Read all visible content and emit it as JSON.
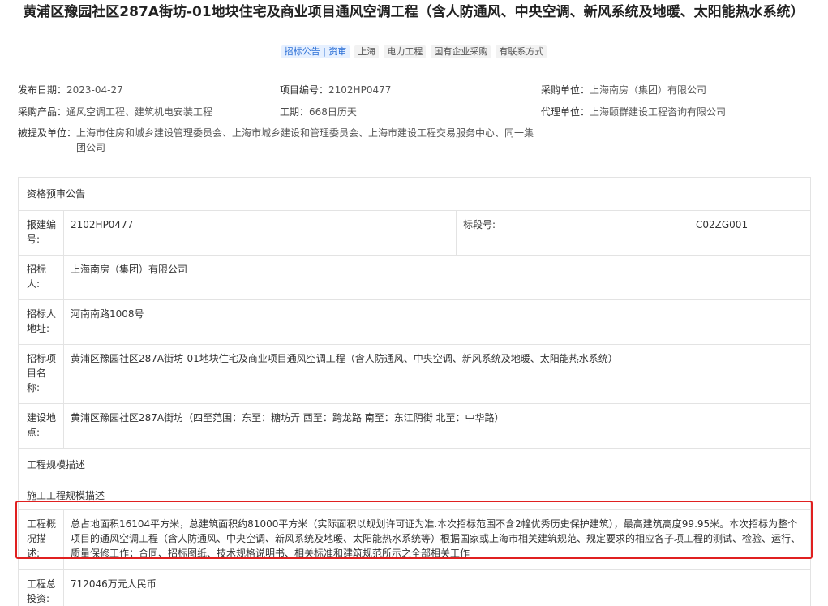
{
  "title": "黄浦区豫园社区287A街坊-01地块住宅及商业项目通风空调工程（含人防通风、中央空调、新风系统及地暖、太阳能热水系统）",
  "tags": [
    "招标公告 | 资审",
    "上海",
    "电力工程",
    "国有企业采购",
    "有联系方式"
  ],
  "meta": {
    "publish_date_label": "发布日期：",
    "publish_date": "2023-04-27",
    "project_no_label": "项目编号：",
    "project_no": "2102HP0477",
    "buyer_label": "采购单位：",
    "buyer": "上海南房（集团）有限公司",
    "product_label": "采购产品：",
    "product": "通风空调工程、建筑机电安装工程",
    "duration_label": "工期：",
    "duration": "668日历天",
    "agent_label": "代理单位：",
    "agent": "上海颐群建设工程咨询有限公司",
    "mentioned_label": "被提及单位：",
    "mentioned": "上海市住房和城乡建设管理委员会、上海市城乡建设和管理委员会、上海市建设工程交易服务中心、同一集团公司"
  },
  "table": {
    "section_title": "资格预审公告",
    "report_no_label": "报建编号:",
    "report_no": "2102HP0477",
    "lot_no_label": "标段号:",
    "lot_no": "C02ZG001",
    "tenderer_label": "招标人:",
    "tenderer": "上海南房（集团）有限公司",
    "tenderer_addr_label": "招标人地址:",
    "tenderer_addr": "河南南路1008号",
    "project_name_label": "招标项目名称:",
    "project_name": "黄浦区豫园社区287A街坊-01地块住宅及商业项目通风空调工程（含人防通风、中央空调、新风系统及地暖、太阳能热水系统）",
    "site_label": "建设地点:",
    "site": "黄浦区豫园社区287A街坊（四至范围：东至：糖坊弄 西至：跨龙路 南至：东江阴街 北至：中华路）",
    "scale_desc": "工程规模描述",
    "construction_scale_desc": "施工工程规模描述",
    "overview_label": "工程概况描述:",
    "overview": "总占地面积16104平方米，总建筑面积约81000平方米（实际面积以规划许可证为准.本次招标范围不含2幢优秀历史保护建筑），最高建筑高度99.95米。本次招标为整个项目的通风空调工程（含人防通风、中央空调、新风系统及地暖、太阳能热水系统等）根据国家或上海市相关建筑规范、规定要求的相应各子项工程的测试、检验、运行、质量保修工作；合同、招标图纸、技术规格说明书、相关标准和建筑规范所示之全部相关工作",
    "investment_label": "工程总投资:",
    "investment": "712046万元人民币"
  },
  "colors": {
    "highlight": "#e02020",
    "tag_primary": "#2b6fd6"
  }
}
